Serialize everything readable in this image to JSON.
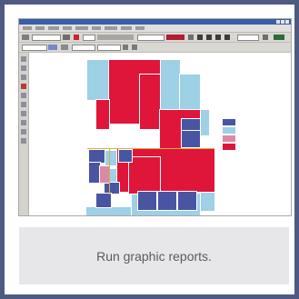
{
  "caption": {
    "text": "Run graphic reports."
  },
  "colors": {
    "frame": "#4f5a82",
    "caption_bg": "#e7e7ea",
    "room_red": "#e0153a",
    "room_navy": "#4a55a2",
    "room_lightblue": "#9ed0e6",
    "room_pink": "#d88aa8"
  },
  "screenshot": {
    "legend": {
      "title": "",
      "items": [
        {
          "label": "",
          "color": "#4a55a2"
        },
        {
          "label": "",
          "color": "#9ed0e6"
        },
        {
          "label": "",
          "color": "#d88aa8"
        },
        {
          "label": "",
          "color": "#e0153a"
        }
      ]
    }
  }
}
